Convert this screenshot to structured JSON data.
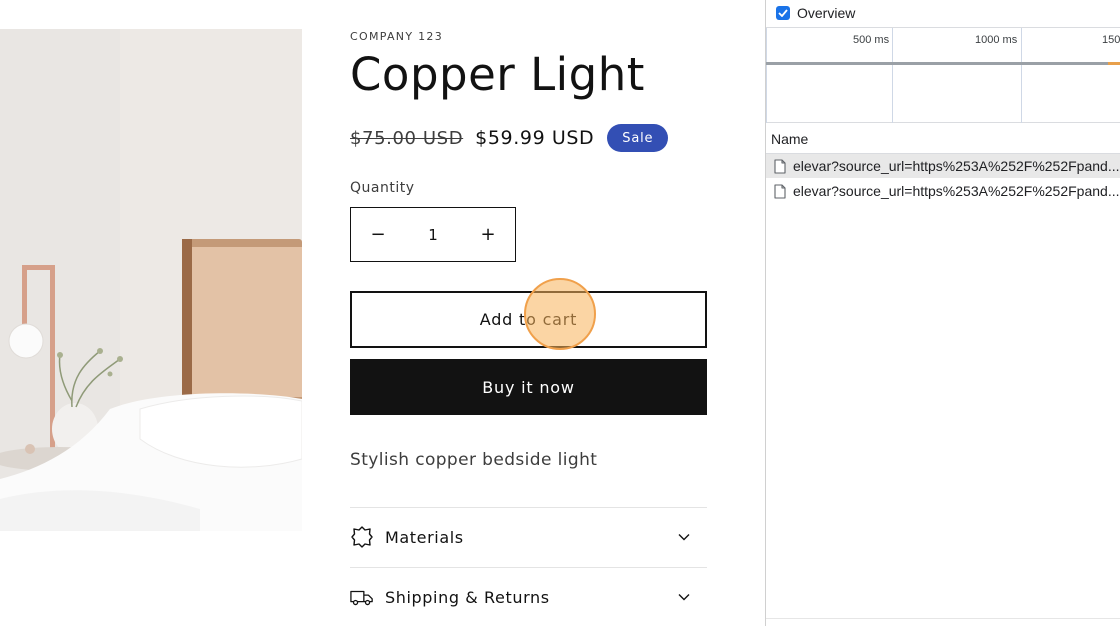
{
  "product": {
    "vendor": "COMPANY 123",
    "title": "Copper Light",
    "price_compare": "$75.00 USD",
    "price_sale": "$59.99 USD",
    "sale_badge": "Sale",
    "quantity_label": "Quantity",
    "quantity_value": "1",
    "decrement_symbol": "−",
    "increment_symbol": "+",
    "add_to_cart_label": "Add to cart",
    "buy_now_label": "Buy it now",
    "description": "Stylish copper bedside light",
    "image_icon": "product-photo"
  },
  "accordions": [
    {
      "label": "Materials",
      "icon": "materials-icon"
    },
    {
      "label": "Shipping & Returns",
      "icon": "truck-icon"
    }
  ],
  "devtools": {
    "overview_label": "Overview",
    "overview_checked": true,
    "timeline_ticks": [
      "500 ms",
      "1000 ms",
      "150"
    ],
    "name_header": "Name",
    "requests": [
      {
        "name": "elevar?source_url=https%253A%252F%252Fpand...",
        "selected": true
      },
      {
        "name": "elevar?source_url=https%253A%252F%252Fpand...",
        "selected": false
      }
    ]
  },
  "colors": {
    "accent_badge": "#334fb4",
    "buy_button": "#121212",
    "devtools_checkbox": "#1a73e8",
    "click_indicator": "#f0a04b"
  }
}
